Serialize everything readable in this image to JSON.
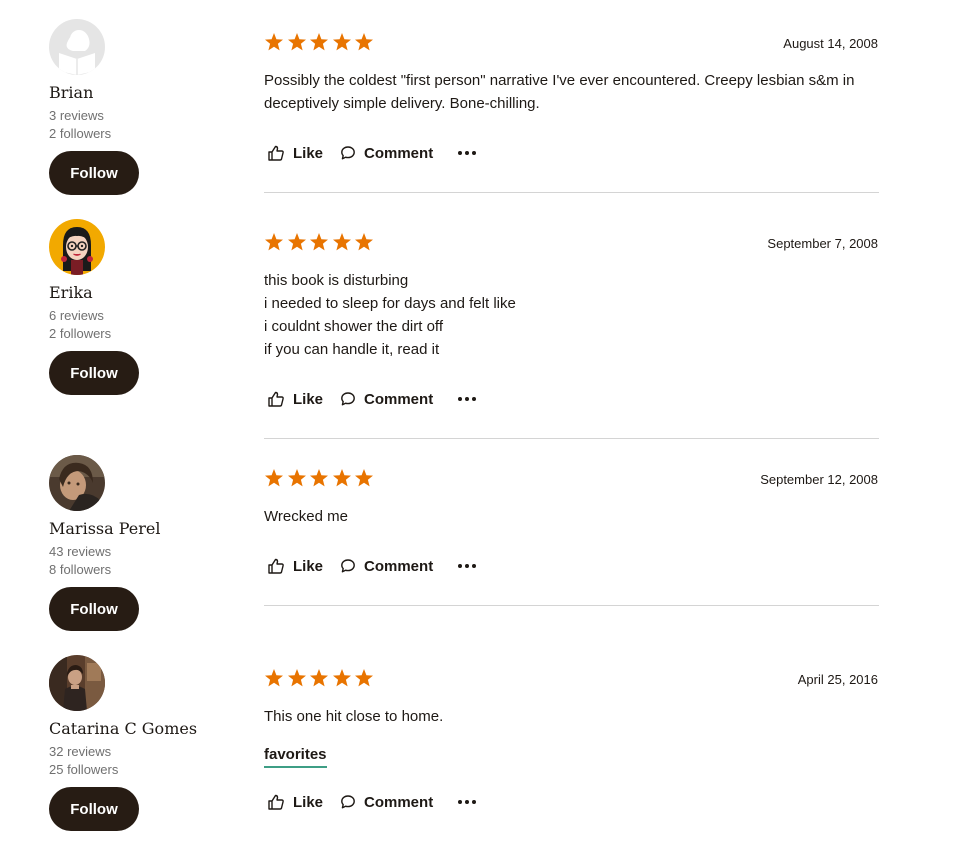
{
  "colors": {
    "star": "#e87400",
    "follow_button": "#271c14",
    "shelf_underline": "#3e9e85",
    "divider": "#d4d4d4"
  },
  "actions": {
    "like_label": "Like",
    "comment_label": "Comment",
    "more_icon": "more-icon"
  },
  "reviews": [
    {
      "reviewer": {
        "name": "Brian",
        "reviews": "3 reviews",
        "followers": "2 followers",
        "follow_label": "Follow",
        "avatar": "default-reader-avatar"
      },
      "rating": 5,
      "date": "August 14, 2008",
      "text": [
        "Possibly the coldest \"first person\" narrative I've ever encountered. Creepy lesbian s&m in deceptively simple delivery. Bone-chilling."
      ]
    },
    {
      "reviewer": {
        "name": "Erika",
        "reviews": "6 reviews",
        "followers": "2 followers",
        "follow_label": "Follow",
        "avatar": "cartoon-avatar"
      },
      "rating": 5,
      "date": "September 7, 2008",
      "text": [
        "this book is disturbing",
        "i needed to sleep for days and felt like",
        "i couldnt shower the dirt off",
        "if you can handle it, read it"
      ]
    },
    {
      "reviewer": {
        "name": "Marissa Perel",
        "reviews": "43 reviews",
        "followers": "8 followers",
        "follow_label": "Follow",
        "avatar": "photo-avatar"
      },
      "rating": 5,
      "date": "September 12, 2008",
      "text": [
        "Wrecked me"
      ]
    },
    {
      "reviewer": {
        "name": "Catarina C Gomes",
        "reviews": "32 reviews",
        "followers": "25 followers",
        "follow_label": "Follow",
        "avatar": "photo-avatar"
      },
      "rating": 5,
      "date": "April 25, 2016",
      "text": [
        "This one hit close to home."
      ],
      "shelf": "favorites"
    }
  ]
}
